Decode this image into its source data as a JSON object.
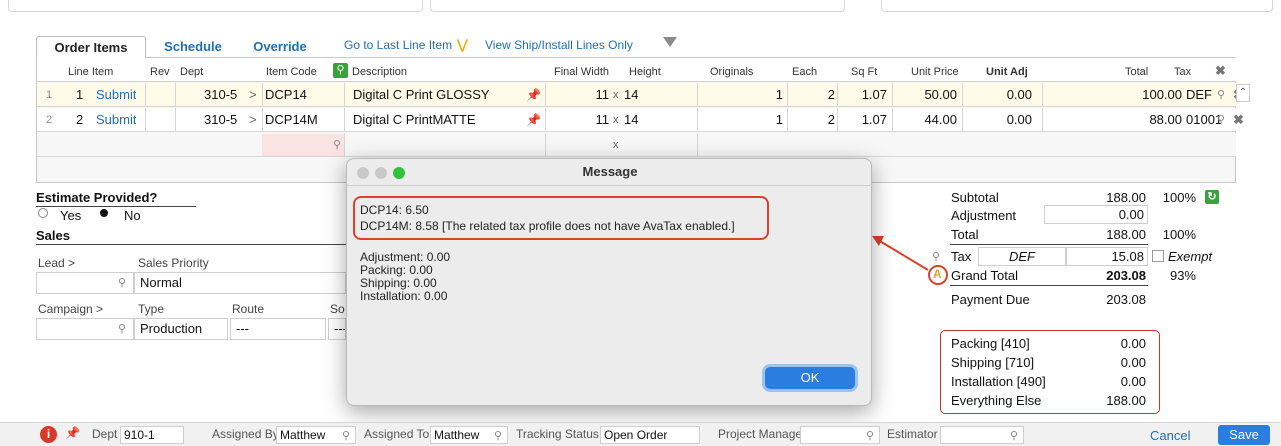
{
  "tabs": [
    {
      "label": "Order Items"
    },
    {
      "label": "Schedule"
    },
    {
      "label": "Override"
    }
  ],
  "links": {
    "go_last": "Go to Last Line Item",
    "view_ship": "View Ship/Install Lines Only"
  },
  "grid": {
    "headers": {
      "line_item": "Line Item",
      "rev": "Rev",
      "dept": "Dept",
      "item_code": "Item Code",
      "description": "Description",
      "final_width": "Final Width",
      "height": "Height",
      "originals": "Originals",
      "each": "Each",
      "sq_ft": "Sq Ft",
      "unit_price": "Unit Price",
      "unit_adj": "Unit Adj",
      "total": "Total",
      "tax": "Tax"
    },
    "rows": [
      {
        "idx": "1",
        "num": "1",
        "action": "Submit",
        "dept": "310-5",
        "arrow": ">",
        "code": "DCP14",
        "description": "Digital C Print GLOSSY",
        "width": "11",
        "x": "x",
        "height": "14",
        "originals": "1",
        "each": "2",
        "sqft": "1.07",
        "unit_price": "50.00",
        "unit_adj": "0.00",
        "total": "100.00",
        "tax": "DEF"
      },
      {
        "idx": "2",
        "num": "2",
        "action": "Submit",
        "dept": "310-5",
        "arrow": ">",
        "code": "DCP14M",
        "description": "Digital C PrintMATTE",
        "width": "11",
        "x": "x",
        "height": "14",
        "originals": "1",
        "each": "2",
        "sqft": "1.07",
        "unit_price": "44.00",
        "unit_adj": "0.00",
        "total": "88.00",
        "tax": "01001"
      }
    ],
    "blank_x": "x"
  },
  "estimate": {
    "title": "Estimate Provided?",
    "yes": "Yes",
    "no": "No"
  },
  "sales": {
    "title": "Sales",
    "lead_label": "Lead >",
    "priority_label": "Sales Priority",
    "priority_value": "Normal",
    "campaign_label": "Campaign >",
    "type_label": "Type",
    "type_value": "Production",
    "route_label": "Route",
    "route_value": "---",
    "source_label": "So",
    "source_value": "---"
  },
  "dialog": {
    "title": "Message",
    "line1": "DCP14: 6.50",
    "line2": "DCP14M: 8.58 [The related tax profile does not have AvaTax enabled.]",
    "adj": "Adjustment: 0.00",
    "packing": "Packing: 0.00",
    "shipping": "Shipping: 0.00",
    "installation": "Installation: 0.00",
    "ok": "OK"
  },
  "totals": {
    "subtotal_label": "Subtotal",
    "subtotal": "188.00",
    "subtotal_pct": "100%",
    "adjustment_label": "Adjustment",
    "adjustment": "0.00",
    "total_label": "Total",
    "total": "188.00",
    "total_pct": "100%",
    "tax_label": "Tax",
    "tax_code": "DEF",
    "tax": "15.08",
    "exempt_label": "Exempt",
    "grand_label": "Grand Total",
    "grand": "203.08",
    "grand_pct": "93%",
    "payment_label": "Payment Due",
    "payment": "203.08",
    "ava_glyph": "A"
  },
  "breakdown": [
    {
      "label": "Packing [410]",
      "value": "0.00"
    },
    {
      "label": "Shipping [710]",
      "value": "0.00"
    },
    {
      "label": "Installation [490]",
      "value": "0.00"
    },
    {
      "label": "Everything Else",
      "value": "188.00"
    }
  ],
  "footer": {
    "info_glyph": "i",
    "dept_label": "Dept",
    "dept_value": "910-1",
    "assigned_by_label": "Assigned By",
    "assigned_by": "Matthew",
    "assigned_to_label": "Assigned To",
    "assigned_to": "Matthew",
    "tracking_label": "Tracking Status",
    "tracking": "Open Order",
    "pm_label": "Project Manager",
    "estimator_label": "Estimator",
    "cancel": "Cancel",
    "save": "Save"
  },
  "colors": {
    "link": "#1f6fb5",
    "highlight_red": "#d9432a",
    "ok_button": "#2b7ee0",
    "save_button": "#2b7ee0",
    "green_icon": "#3aa23a"
  }
}
